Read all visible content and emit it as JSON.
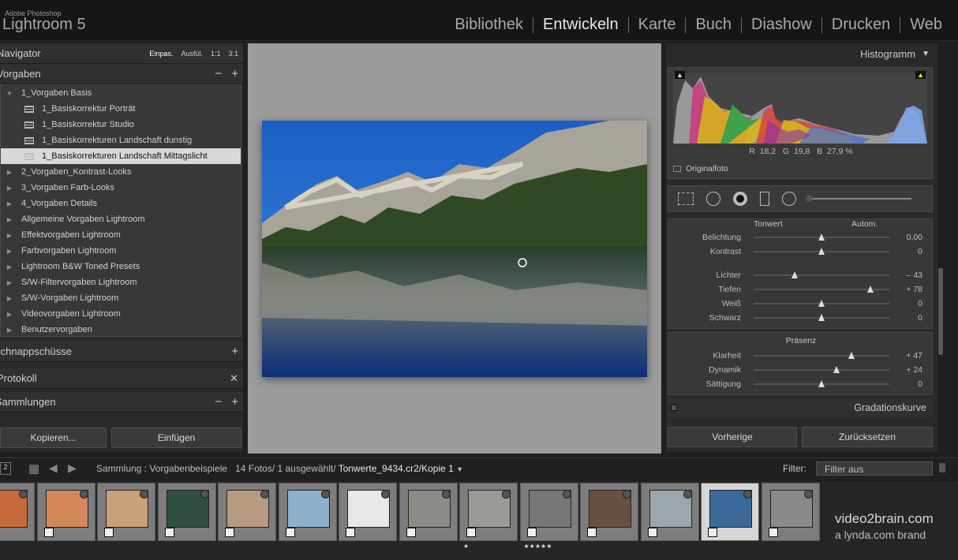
{
  "app": {
    "vendor": "Adobe Photoshop",
    "product": "Lightroom 5"
  },
  "modules": [
    "Bibliothek",
    "Entwickeln",
    "Karte",
    "Buch",
    "Diashow",
    "Drucken",
    "Web"
  ],
  "active_module": "Entwickeln",
  "left": {
    "navigator": {
      "title": "Navigator",
      "zoom": [
        "Einpas.",
        "Ausfül.",
        "1:1",
        "3:1"
      ]
    },
    "presets": {
      "title": "Vorgaben",
      "tree": [
        {
          "label": "1_Vorgaben Basis",
          "level": 0,
          "open": true
        },
        {
          "label": "1_Basiskorrektur Porträt",
          "level": 1
        },
        {
          "label": "1_Basiskorrektur Studio",
          "level": 1
        },
        {
          "label": "1_Basiskorrekturen Landschaft dunstig",
          "level": 1
        },
        {
          "label": "1_Basiskorrekturen Landschaft Mittagslicht",
          "level": 1,
          "selected": true
        },
        {
          "label": "2_Vorgaben_Kontrast-Looks",
          "level": 0
        },
        {
          "label": "3_Vorgaben Farb-Looks",
          "level": 0
        },
        {
          "label": "4_Vorgaben Details",
          "level": 0
        },
        {
          "label": "Allgemeine Vorgaben Lightroom",
          "level": 0
        },
        {
          "label": "Effektvorgaben Lightroom",
          "level": 0
        },
        {
          "label": "Farbvorgaben Lightroom",
          "level": 0
        },
        {
          "label": "Lightroom B&W Toned Presets",
          "level": 0
        },
        {
          "label": "S/W-Filtervorgaben Lightroom",
          "level": 0
        },
        {
          "label": "S/W-Vorgaben Lightroom",
          "level": 0
        },
        {
          "label": "Videovorgaben Lightroom",
          "level": 0
        },
        {
          "label": "Benutzervorgaben",
          "level": 0
        }
      ]
    },
    "snapshots": "Schnappschüsse",
    "history": "Protokoll",
    "collections": "Sammlungen",
    "copy_btn": "Kopieren...",
    "paste_btn": "Einfügen"
  },
  "right": {
    "histogram": {
      "title": "Histogramm",
      "r_label": "R",
      "r": "18,2",
      "g_label": "G",
      "g": "19,8",
      "b_label": "B",
      "b": "27,9",
      "pct": "%",
      "original": "Originalfoto"
    },
    "tone": {
      "title": "Tonwert",
      "auto": "Autom.",
      "sliders": [
        {
          "label": "Belichtung",
          "value": "0,00",
          "pos": 0.5
        },
        {
          "label": "Kontrast",
          "value": "0",
          "pos": 0.5
        },
        {
          "label": "Lichter",
          "value": "– 43",
          "pos": 0.3
        },
        {
          "label": "Tiefen",
          "value": "+ 78",
          "pos": 0.86
        },
        {
          "label": "Weiß",
          "value": "0",
          "pos": 0.5
        },
        {
          "label": "Schwarz",
          "value": "0",
          "pos": 0.5
        }
      ]
    },
    "presence": {
      "title": "Präsenz",
      "sliders": [
        {
          "label": "Klarheit",
          "value": "+ 47",
          "pos": 0.72
        },
        {
          "label": "Dynamik",
          "value": "+ 24",
          "pos": 0.61
        },
        {
          "label": "Sättigung",
          "value": "0",
          "pos": 0.5
        }
      ]
    },
    "curve": "Gradationskurve",
    "prev_btn": "Vorherige",
    "reset_btn": "Zurücksetzen"
  },
  "filmbar": {
    "num": "2",
    "collection": "Sammlung : Vorgabenbeispiele",
    "count": "14 Fotos/",
    "selected": "1 ausgewählt/",
    "filename": "Tonwerte_9434.cr2/Kopie 1",
    "filter_label": "Filter:",
    "filter_value": "Filter aus"
  },
  "thumbs": [
    {
      "c": "#c66a3a"
    },
    {
      "c": "#d4875a"
    },
    {
      "c": "#caa07a"
    },
    {
      "c": "#2f4f3f"
    },
    {
      "c": "#b89a80"
    },
    {
      "c": "#8fb0cc"
    },
    {
      "c": "#e8e8e8"
    },
    {
      "c": "#8c8c86"
    },
    {
      "c": "#9b9b95"
    },
    {
      "c": "#777"
    },
    {
      "c": "#6a5040"
    },
    {
      "c": "#9aa5ac"
    },
    {
      "c": "#3b6a9a",
      "sel": true
    },
    {
      "c": "#8a8a8a"
    }
  ],
  "stars1": "★",
  "stars5": "★★★★★",
  "watermark": {
    "line1": "video2brain.com",
    "line2": "a lynda.com brand"
  }
}
